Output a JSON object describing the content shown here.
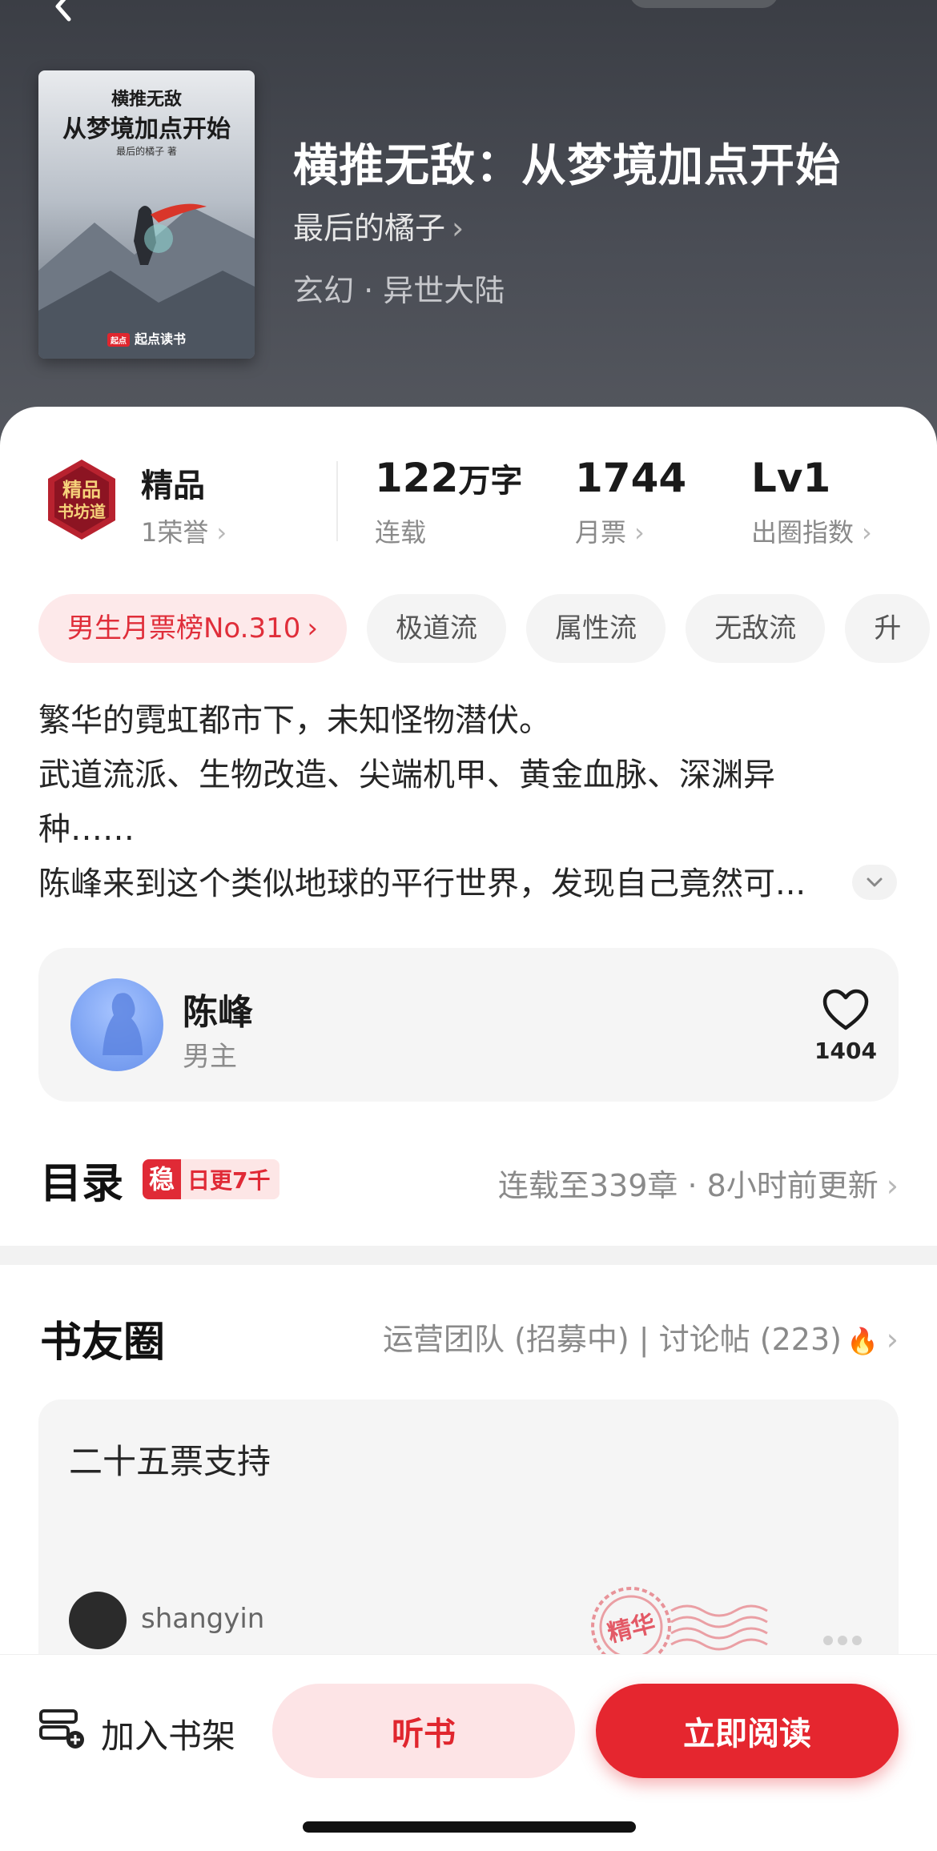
{
  "header": {
    "book_title": "横推无敌：从梦境加点开始",
    "author": "最后的橘子",
    "genre": "玄幻 · 异世大陆",
    "cover": {
      "title_small": "横推无敌",
      "title_big": "从梦境加点开始",
      "author_line": "最后的橘子 著",
      "brand_logo": "起点",
      "brand": "起点读书"
    }
  },
  "stats": {
    "honor": {
      "label": "精品",
      "sub": "1荣誉"
    },
    "words": {
      "value": "122",
      "unit": "万字",
      "sub": "连载"
    },
    "monthly_tickets": {
      "value": "1744",
      "sub": "月票"
    },
    "circle_index": {
      "value": "Lv1",
      "sub": "出圈指数"
    }
  },
  "tags": [
    {
      "label": "男生月票榜No.310",
      "kind": "rank"
    },
    {
      "label": "极道流"
    },
    {
      "label": "属性流"
    },
    {
      "label": "无敌流"
    },
    {
      "label": "升"
    }
  ],
  "synopsis": [
    "繁华的霓虹都市下，未知怪物潜伏。",
    "武道流派、生物改造、尖端机甲、黄金血脉、深渊异",
    "种……",
    "陈峰来到这个类似地球的平行世界，发现自己竟然可..."
  ],
  "character": {
    "name": "陈峰",
    "role": "男主",
    "likes": "1404"
  },
  "toc": {
    "title": "目录",
    "badge_icon": "稳",
    "badge_text": "日更7千",
    "meta": "连载至339章 · 8小时前更新"
  },
  "circle": {
    "title": "书友圈",
    "meta": "运营团队 (招募中) | 讨论帖 (223)",
    "post": {
      "text": "二十五票支持",
      "user": "shangyin",
      "stamp": "精华"
    }
  },
  "bottom": {
    "shelf": "加入书架",
    "listen": "听书",
    "read": "立即阅读"
  },
  "colors": {
    "accent": "#e5262f",
    "accent_light": "#fde4e6",
    "header_bg": "#44474e"
  }
}
